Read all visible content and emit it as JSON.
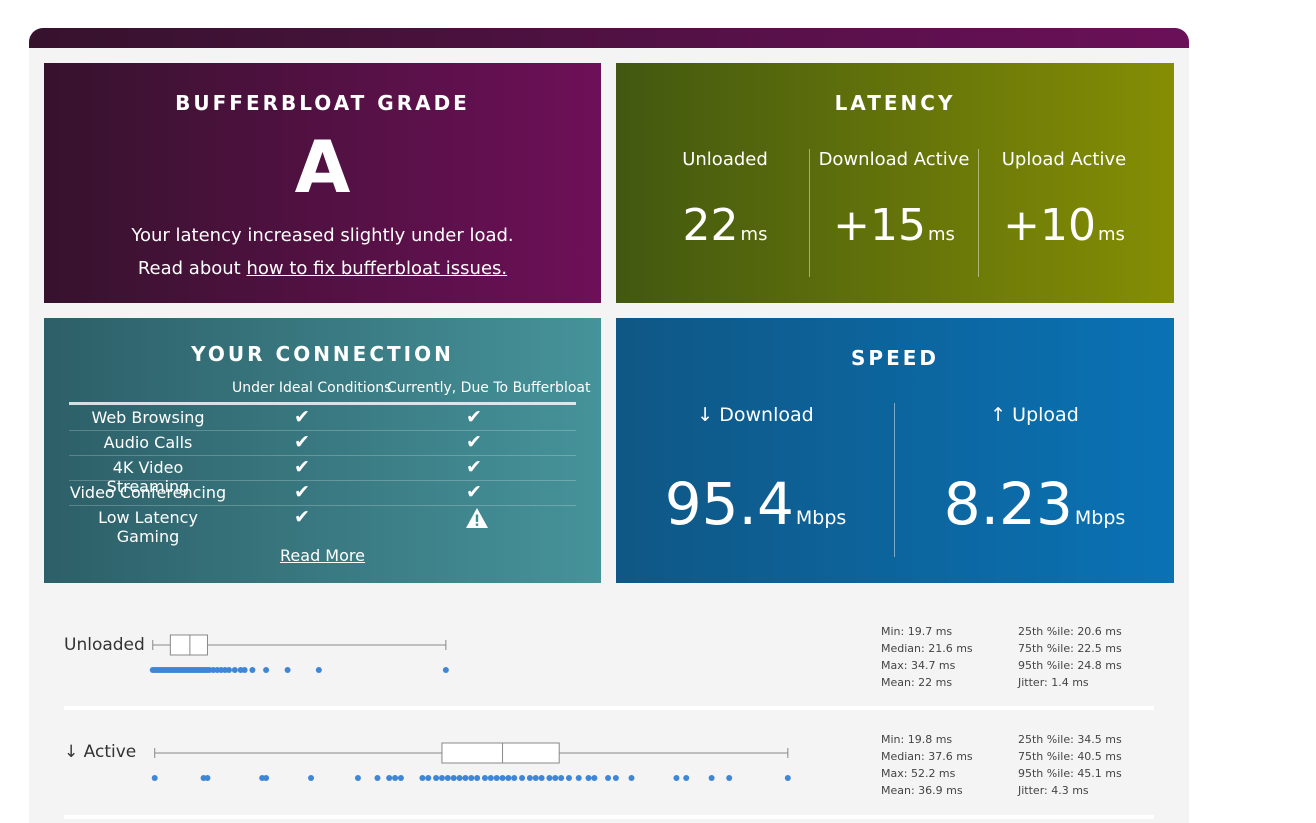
{
  "grade": {
    "title": "BUFFERBLOAT GRADE",
    "letter": "A",
    "description": "Your latency increased slightly under load.",
    "link_prefix": "Read about ",
    "link_text": "how to fix bufferbloat issues."
  },
  "latency": {
    "title": "LATENCY",
    "unloaded_label": "Unloaded",
    "unloaded_value": "22",
    "download_label": "Download Active",
    "download_value": "+15",
    "upload_label": "Upload Active",
    "upload_value": "+10",
    "unit": "ms"
  },
  "connection": {
    "title": "YOUR CONNECTION",
    "col1": "Under Ideal Conditions",
    "col2": "Currently, Due To Bufferbloat",
    "rows": [
      {
        "name": "Web Browsing",
        "ideal": "✔",
        "current": "✔"
      },
      {
        "name": "Audio Calls",
        "ideal": "✔",
        "current": "✔"
      },
      {
        "name": "4K Video Streaming",
        "ideal": "✔",
        "current": "✔"
      },
      {
        "name": "Video Conferencing",
        "ideal": "✔",
        "current": "✔"
      },
      {
        "name": "Low Latency Gaming",
        "ideal": "✔",
        "current": "warning-icon"
      }
    ],
    "read_more": "Read More"
  },
  "speed": {
    "title": "SPEED",
    "download_label": "↓ Download",
    "download_value": "95.4",
    "upload_label": "↑ Upload",
    "upload_value": "8.23",
    "unit": "Mbps"
  },
  "plots": {
    "axis_min_ms": 17,
    "axis_max_ms": 54,
    "unloaded": {
      "label": "Unloaded",
      "min": 19.7,
      "q1": 20.6,
      "median": 21.6,
      "q3": 22.5,
      "max": 34.7,
      "points": [
        19.7,
        19.8,
        19.9,
        20.0,
        20.1,
        20.2,
        20.3,
        20.4,
        20.5,
        20.6,
        20.7,
        20.8,
        20.9,
        21.0,
        21.1,
        21.2,
        21.3,
        21.4,
        21.5,
        21.6,
        21.7,
        21.8,
        21.9,
        22.0,
        22.1,
        22.2,
        22.3,
        22.4,
        22.5,
        22.6,
        22.8,
        23.0,
        23.2,
        23.4,
        23.6,
        23.9,
        24.2,
        24.4,
        24.8,
        25.5,
        26.6,
        28.2,
        34.7
      ],
      "stats_left": [
        "Min: 19.7 ms",
        "Median: 21.6 ms",
        "Max: 34.7 ms",
        "Mean: 22 ms"
      ],
      "stats_right": [
        "25th %ile: 20.6 ms",
        "75th %ile: 22.5 ms",
        "95th %ile: 24.8 ms",
        "Jitter: 1.4 ms"
      ]
    },
    "active": {
      "label": "↓ Active",
      "min": 19.8,
      "q1": 34.5,
      "median": 37.6,
      "q3": 40.5,
      "max": 52.2,
      "points": [
        19.8,
        22.3,
        22.5,
        25.3,
        25.5,
        27.8,
        30.2,
        31.2,
        31.8,
        32.1,
        32.4,
        33.5,
        33.8,
        34.2,
        34.5,
        34.8,
        35.1,
        35.4,
        35.7,
        36.0,
        36.3,
        36.7,
        37.0,
        37.3,
        37.6,
        37.9,
        38.2,
        38.6,
        39.0,
        39.3,
        39.6,
        40.0,
        40.3,
        40.6,
        41.0,
        41.5,
        42.0,
        42.3,
        43.0,
        43.4,
        44.2,
        46.5,
        47.0,
        48.3,
        49.2,
        52.2
      ],
      "stats_left": [
        "Min: 19.8 ms",
        "Median: 37.6 ms",
        "Max: 52.2 ms",
        "Mean: 36.9 ms"
      ],
      "stats_right": [
        "25th %ile: 34.5 ms",
        "75th %ile: 40.5 ms",
        "95th %ile: 45.1 ms",
        "Jitter: 4.3 ms"
      ]
    },
    "colors": {
      "dot": "#3f86d6",
      "box": "#888888"
    }
  }
}
